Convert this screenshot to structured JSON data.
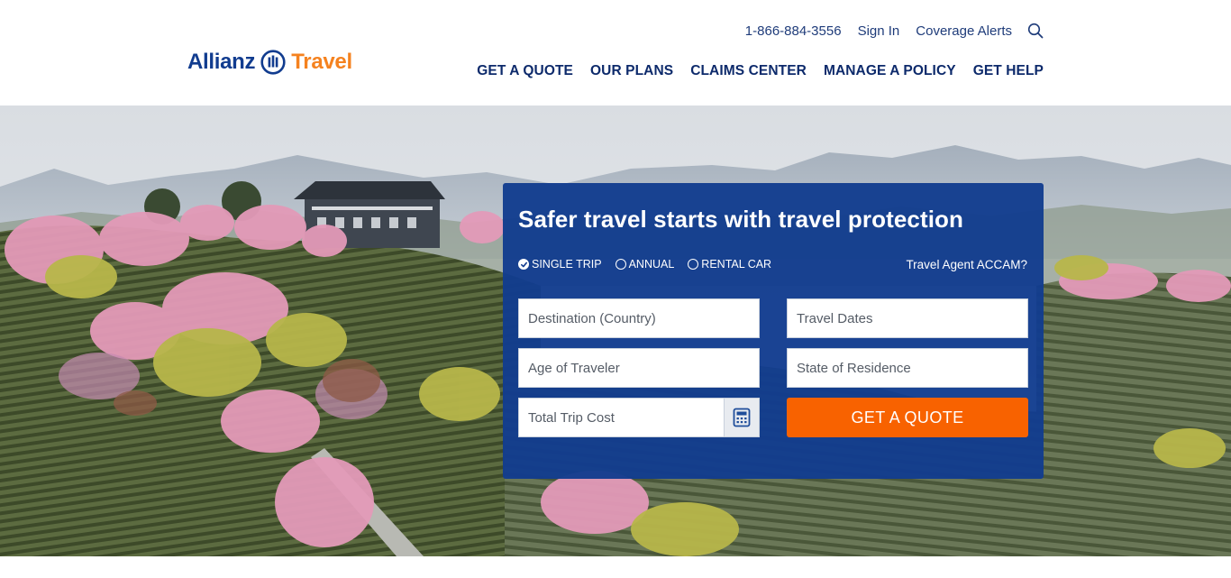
{
  "brand": {
    "name_part1": "Allianz",
    "name_part2": "Travel",
    "colors": {
      "navy": "#113c8f",
      "orange": "#f5821f"
    }
  },
  "utility_nav": {
    "phone": "1-866-884-3556",
    "sign_in": "Sign In",
    "coverage_alerts": "Coverage Alerts",
    "search_icon": "search-icon"
  },
  "main_nav": {
    "items": [
      {
        "label": "GET A QUOTE"
      },
      {
        "label": "OUR PLANS"
      },
      {
        "label": "CLAIMS CENTER"
      },
      {
        "label": "MANAGE A POLICY"
      },
      {
        "label": "GET HELP"
      }
    ]
  },
  "hero": {
    "image_subject": "tea plantation terraces with cherry blossom trees and a house on a hill"
  },
  "quote_form": {
    "title": "Safer travel starts with travel protection",
    "trip_types": [
      {
        "label": "SINGLE TRIP",
        "selected": true
      },
      {
        "label": "ANNUAL",
        "selected": false
      },
      {
        "label": "RENTAL CAR",
        "selected": false
      }
    ],
    "agent_link": "Travel Agent ACCAM?",
    "fields": {
      "destination_placeholder": "Destination (Country)",
      "dates_placeholder": "Travel Dates",
      "age_placeholder": "Age of Traveler",
      "state_placeholder": "State of Residence",
      "cost_placeholder": "Total Trip Cost"
    },
    "calculator_icon": "calculator-icon",
    "submit_label": "GET A QUOTE",
    "colors": {
      "panel": "#123c8f",
      "button": "#f86200"
    }
  }
}
